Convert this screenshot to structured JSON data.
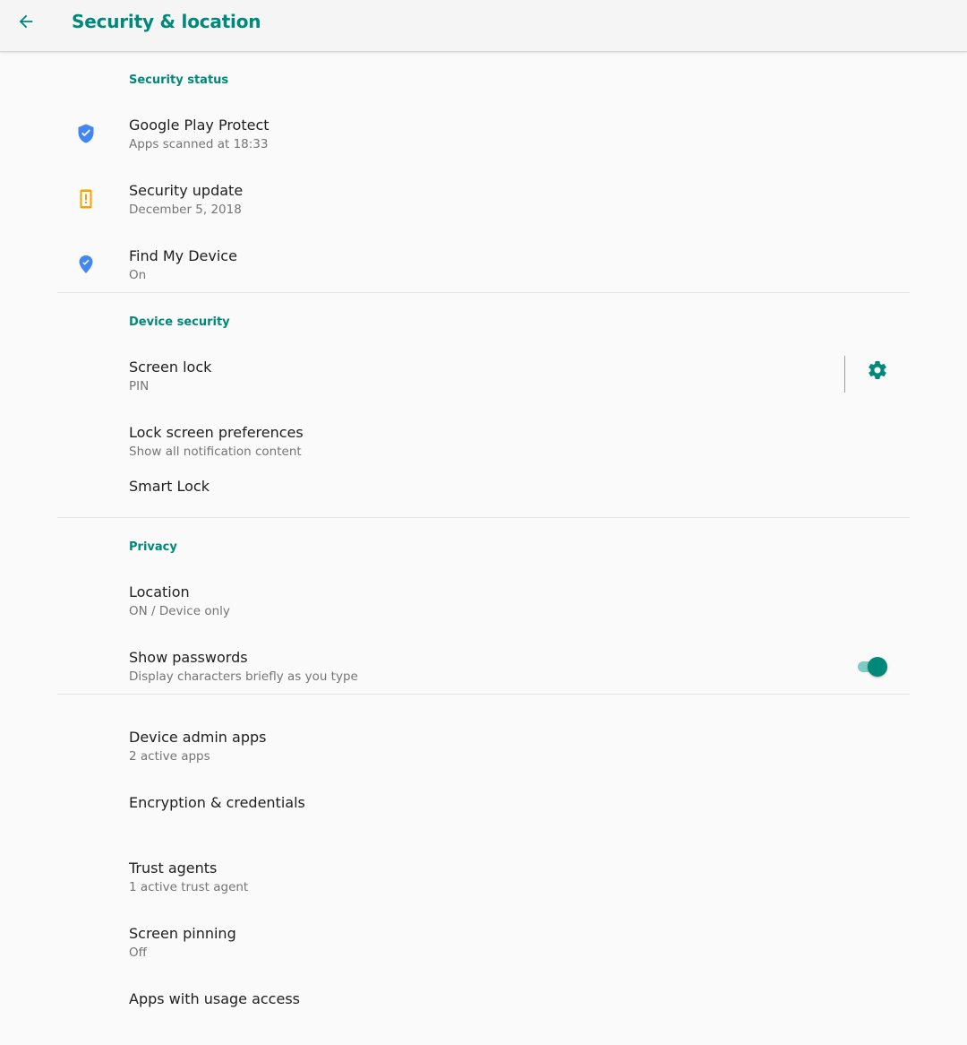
{
  "appbar": {
    "title": "Security & location",
    "back_icon": "arrow-back-icon"
  },
  "colors": {
    "accent": "#00897b",
    "shield_blue": "#4285f4",
    "update_orange": "#f4a300",
    "title_text": "#202020",
    "summary_text": "#757575"
  },
  "security_status": {
    "header": "Security status",
    "items": [
      {
        "title": "Google Play Protect",
        "summary": "Apps scanned at 18:33",
        "icon": "play-protect-shield-icon"
      },
      {
        "title": "Security update",
        "summary": "December 5, 2018",
        "icon": "security-update-icon"
      },
      {
        "title": "Find My Device",
        "summary": "On",
        "icon": "find-my-device-icon"
      }
    ]
  },
  "device_security": {
    "header": "Device security",
    "items": [
      {
        "title": "Screen lock",
        "summary": "PIN",
        "action_icon": "gear-icon"
      },
      {
        "title": "Lock screen preferences",
        "summary": "Show all notification content"
      },
      {
        "title": "Smart Lock"
      }
    ]
  },
  "privacy": {
    "header": "Privacy",
    "items": [
      {
        "title": "Location",
        "summary": "ON / Device only"
      },
      {
        "title": "Show passwords",
        "summary": "Display characters briefly as you type",
        "toggle_on": true
      }
    ]
  },
  "advanced": {
    "items": [
      {
        "title": "Device admin apps",
        "summary": "2 active apps"
      },
      {
        "title": "Encryption & credentials"
      },
      {
        "title": "Trust agents",
        "summary": "1 active trust agent"
      },
      {
        "title": "Screen pinning",
        "summary": "Off"
      },
      {
        "title": "Apps with usage access"
      }
    ]
  }
}
